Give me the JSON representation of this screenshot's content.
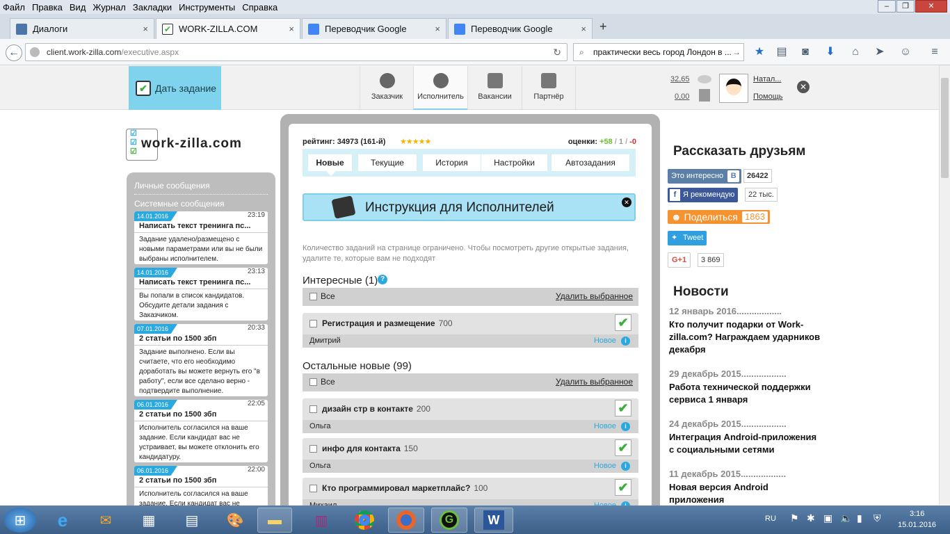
{
  "menu": [
    "Файл",
    "Правка",
    "Вид",
    "Журнал",
    "Закладки",
    "Инструменты",
    "Справка"
  ],
  "window_controls": {
    "min": "–",
    "max": "❐",
    "close": "✕"
  },
  "tabs": [
    {
      "label": "Диалоги",
      "close": "×"
    },
    {
      "label": "WORK-ZILLA.COM",
      "close": "×"
    },
    {
      "label": "Переводчик Google",
      "close": "×"
    },
    {
      "label": "Переводчик Google",
      "close": "×"
    }
  ],
  "new_tab": "+",
  "url": {
    "host": "client.work-zilla.com",
    "path": "/executive.aspx"
  },
  "search_value": "практически весь город Лондон в ...",
  "header": {
    "give_task": "Дать задание",
    "nav": [
      {
        "label": "Заказчик"
      },
      {
        "label": "Исполнитель"
      },
      {
        "label": "Вакансии"
      },
      {
        "label": "Партнёр"
      }
    ],
    "balance1": "32,65",
    "balance2": "0,00",
    "user": "Натал...",
    "help": "Помощь"
  },
  "logo": "work-zilla.com",
  "messages": {
    "cat_personal": "Личные сообщения",
    "cat_system": "Системные сообщения",
    "items": [
      {
        "date": "14.01.2016",
        "time": "23:19",
        "title": "Написать текст тренинга пс...",
        "body": "Задание удалено/размещено с новыми параметрами или вы не были выбраны исполнителем."
      },
      {
        "date": "14.01.2016",
        "time": "23:13",
        "title": "Написать текст тренинга пс...",
        "body": "Вы попали в список кандидатов. Обсудите детали задания с Заказчиком."
      },
      {
        "date": "07.01.2016",
        "time": "20:33",
        "title": "2 статьи по 1500 збп",
        "body": "Задание выполнено. Если вы считаете, что его необходимо доработать вы можете вернуть его \"в работу\", если все сделано верно - подтвердите выполнение."
      },
      {
        "date": "06.01.2016",
        "time": "22:05",
        "title": "2 статьи по 1500 збп",
        "body": "Исполнитель согласился на ваше задание. Если кандидат вас не устраивает, вы можете отклонить его кандидатуру."
      },
      {
        "date": "06.01.2016",
        "time": "22:00",
        "title": "2 статьи по 1500 збп",
        "body": "Исполнитель согласился на ваше задание. Если кандидат вас не"
      }
    ]
  },
  "main": {
    "rating_label": "рейтинг:",
    "rating_value": "34973 (161-й)",
    "stars": "★★★★★",
    "grades_label": "оценки:",
    "grades_pos": "+58",
    "grades_sep1": " / ",
    "grades_neutral": "1",
    "grades_sep2": " / ",
    "grades_neg": "-0",
    "tabs": [
      "Новые",
      "Текущие",
      "История",
      "Настройки",
      "Автозадания"
    ],
    "instruction": "Инструкция для Исполнителей",
    "notice": "Количество заданий на странице ограничено. Чтобы посмотреть другие открытые задания, удалите те, которые вам не подходят",
    "interesting_title": "Интересные (1)",
    "others_title": "Остальные новые (99)",
    "all_label": "Все",
    "delete_selected": "Удалить выбранное",
    "interesting_tasks": [
      {
        "title": "Регистрация и размещение",
        "price": "700",
        "author": "Дмитрий",
        "status": "Новое"
      }
    ],
    "other_tasks": [
      {
        "title": "дизайн стр в контакте",
        "price": "200",
        "author": "Ольга",
        "status": "Новое"
      },
      {
        "title": "инфо для контакта",
        "price": "150",
        "author": "Ольга",
        "status": "Новое"
      },
      {
        "title": "Кто программировал маркетплайс?",
        "price": "100",
        "author": "Михаил",
        "status": "Новое"
      }
    ]
  },
  "share": {
    "title": "Рассказать друзьям",
    "vk_label": "Это интересно",
    "vk_count": "26422",
    "fb_label": "Я рекомендую",
    "fb_count": "22 тыс.",
    "ok_label": "Поделиться",
    "ok_count": "1863",
    "tw_label": "Tweet",
    "gp_label": "G+1",
    "gp_count": "3 869"
  },
  "news": {
    "title": "Новости",
    "items": [
      {
        "date": "12 январь 2016..................",
        "text": "Кто получит подарки от Work-zilla.com? Награждаем ударников декабря"
      },
      {
        "date": "29 декабрь 2015..................",
        "text": "Работа технической поддержки сервиса 1 января"
      },
      {
        "date": "24 декабрь 2015..................",
        "text": "Интеграция Android-приложения с социальными сетями"
      },
      {
        "date": "11 декабрь 2015..................",
        "text": "Новая версия Android приложения"
      }
    ]
  },
  "taskbar": {
    "lang": "RU",
    "time": "3:16",
    "date": "15.01.2016"
  },
  "colors": {
    "accent": "#7fd3ec",
    "link": "#2aa9e0",
    "vk": "#5b7fa6",
    "fb": "#3b5998",
    "ok": "#f59331",
    "tw": "#1da1f2"
  }
}
